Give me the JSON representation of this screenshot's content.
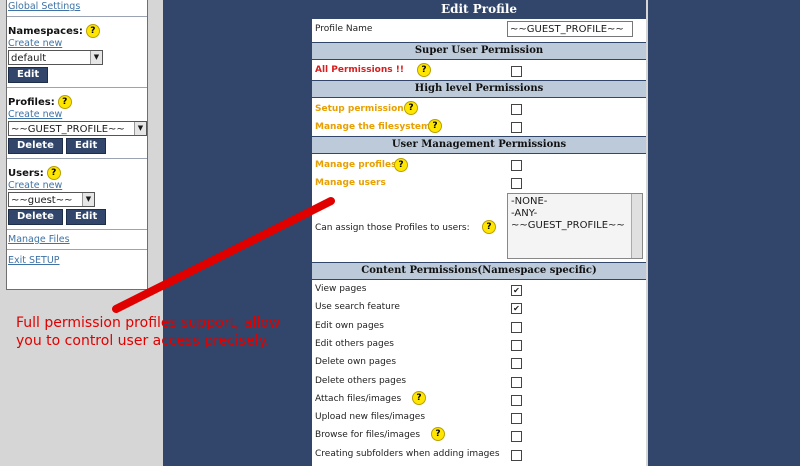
{
  "sidebar": {
    "global_settings": "Global Settings",
    "namespaces": {
      "label": "Namespaces:",
      "create": "Create new",
      "selected": "default",
      "edit": "Edit"
    },
    "profiles": {
      "label": "Profiles:",
      "create": "Create new",
      "selected": "~~GUEST_PROFILE~~",
      "delete": "Delete",
      "edit": "Edit"
    },
    "users": {
      "label": "Users:",
      "create": "Create new",
      "selected": "~~guest~~",
      "delete": "Delete",
      "edit": "Edit"
    },
    "manage_files": "Manage Files",
    "exit_setup": "Exit SETUP"
  },
  "form": {
    "title": "Edit Profile",
    "profile_name_label": "Profile Name",
    "profile_name_value": "~~GUEST_PROFILE~~",
    "super_header": "Super User Permission",
    "all_permissions": "All Permissions",
    "high_header": "High level Permissions",
    "setup_permission": "Setup permission",
    "manage_filesystem": "Manage the filesystem",
    "user_mgmt_header": "User Management Permissions",
    "manage_profiles": "Manage profiles",
    "manage_users": "Manage users",
    "assign_label": "Can assign those Profiles to users:",
    "assign_options": [
      "-NONE-",
      "-ANY-",
      "~~GUEST_PROFILE~~"
    ],
    "content_header": "Content Permissions(Namespace specific)",
    "content_items": [
      {
        "label": "View pages",
        "checked": true
      },
      {
        "label": "Use search feature",
        "checked": true
      },
      {
        "label": "Edit own pages",
        "checked": false
      },
      {
        "label": "Edit others pages",
        "checked": false
      },
      {
        "label": "Delete own pages",
        "checked": false
      },
      {
        "label": "Delete others pages",
        "checked": false
      },
      {
        "label": "Attach files/images",
        "checked": false
      },
      {
        "label": "Upload new files/images",
        "checked": false
      },
      {
        "label": "Browse for files/images",
        "checked": false
      },
      {
        "label": "Creating subfolders when adding images",
        "checked": false
      }
    ]
  },
  "annotation": "Full permission profiles support, allow you to control user access precisely.",
  "colors": {
    "panel": "#31466a",
    "header": "#bccad9",
    "accent": "#e8a000",
    "annotation": "#e00000"
  }
}
